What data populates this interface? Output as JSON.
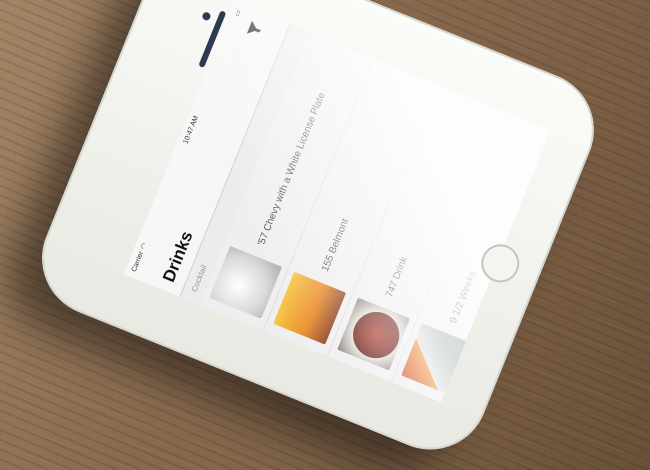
{
  "status_bar": {
    "carrier": "Carrier",
    "time": "10:47 AM"
  },
  "nav": {
    "title": "Drinks",
    "filter_icon": "filter-funnel-icon"
  },
  "section": {
    "label": "Cocktail"
  },
  "drinks": [
    {
      "name": "'57 Chevy with a White License Plate"
    },
    {
      "name": "155 Belmont"
    },
    {
      "name": "747 Drink"
    },
    {
      "name": "9 1/2 Weeks"
    }
  ]
}
